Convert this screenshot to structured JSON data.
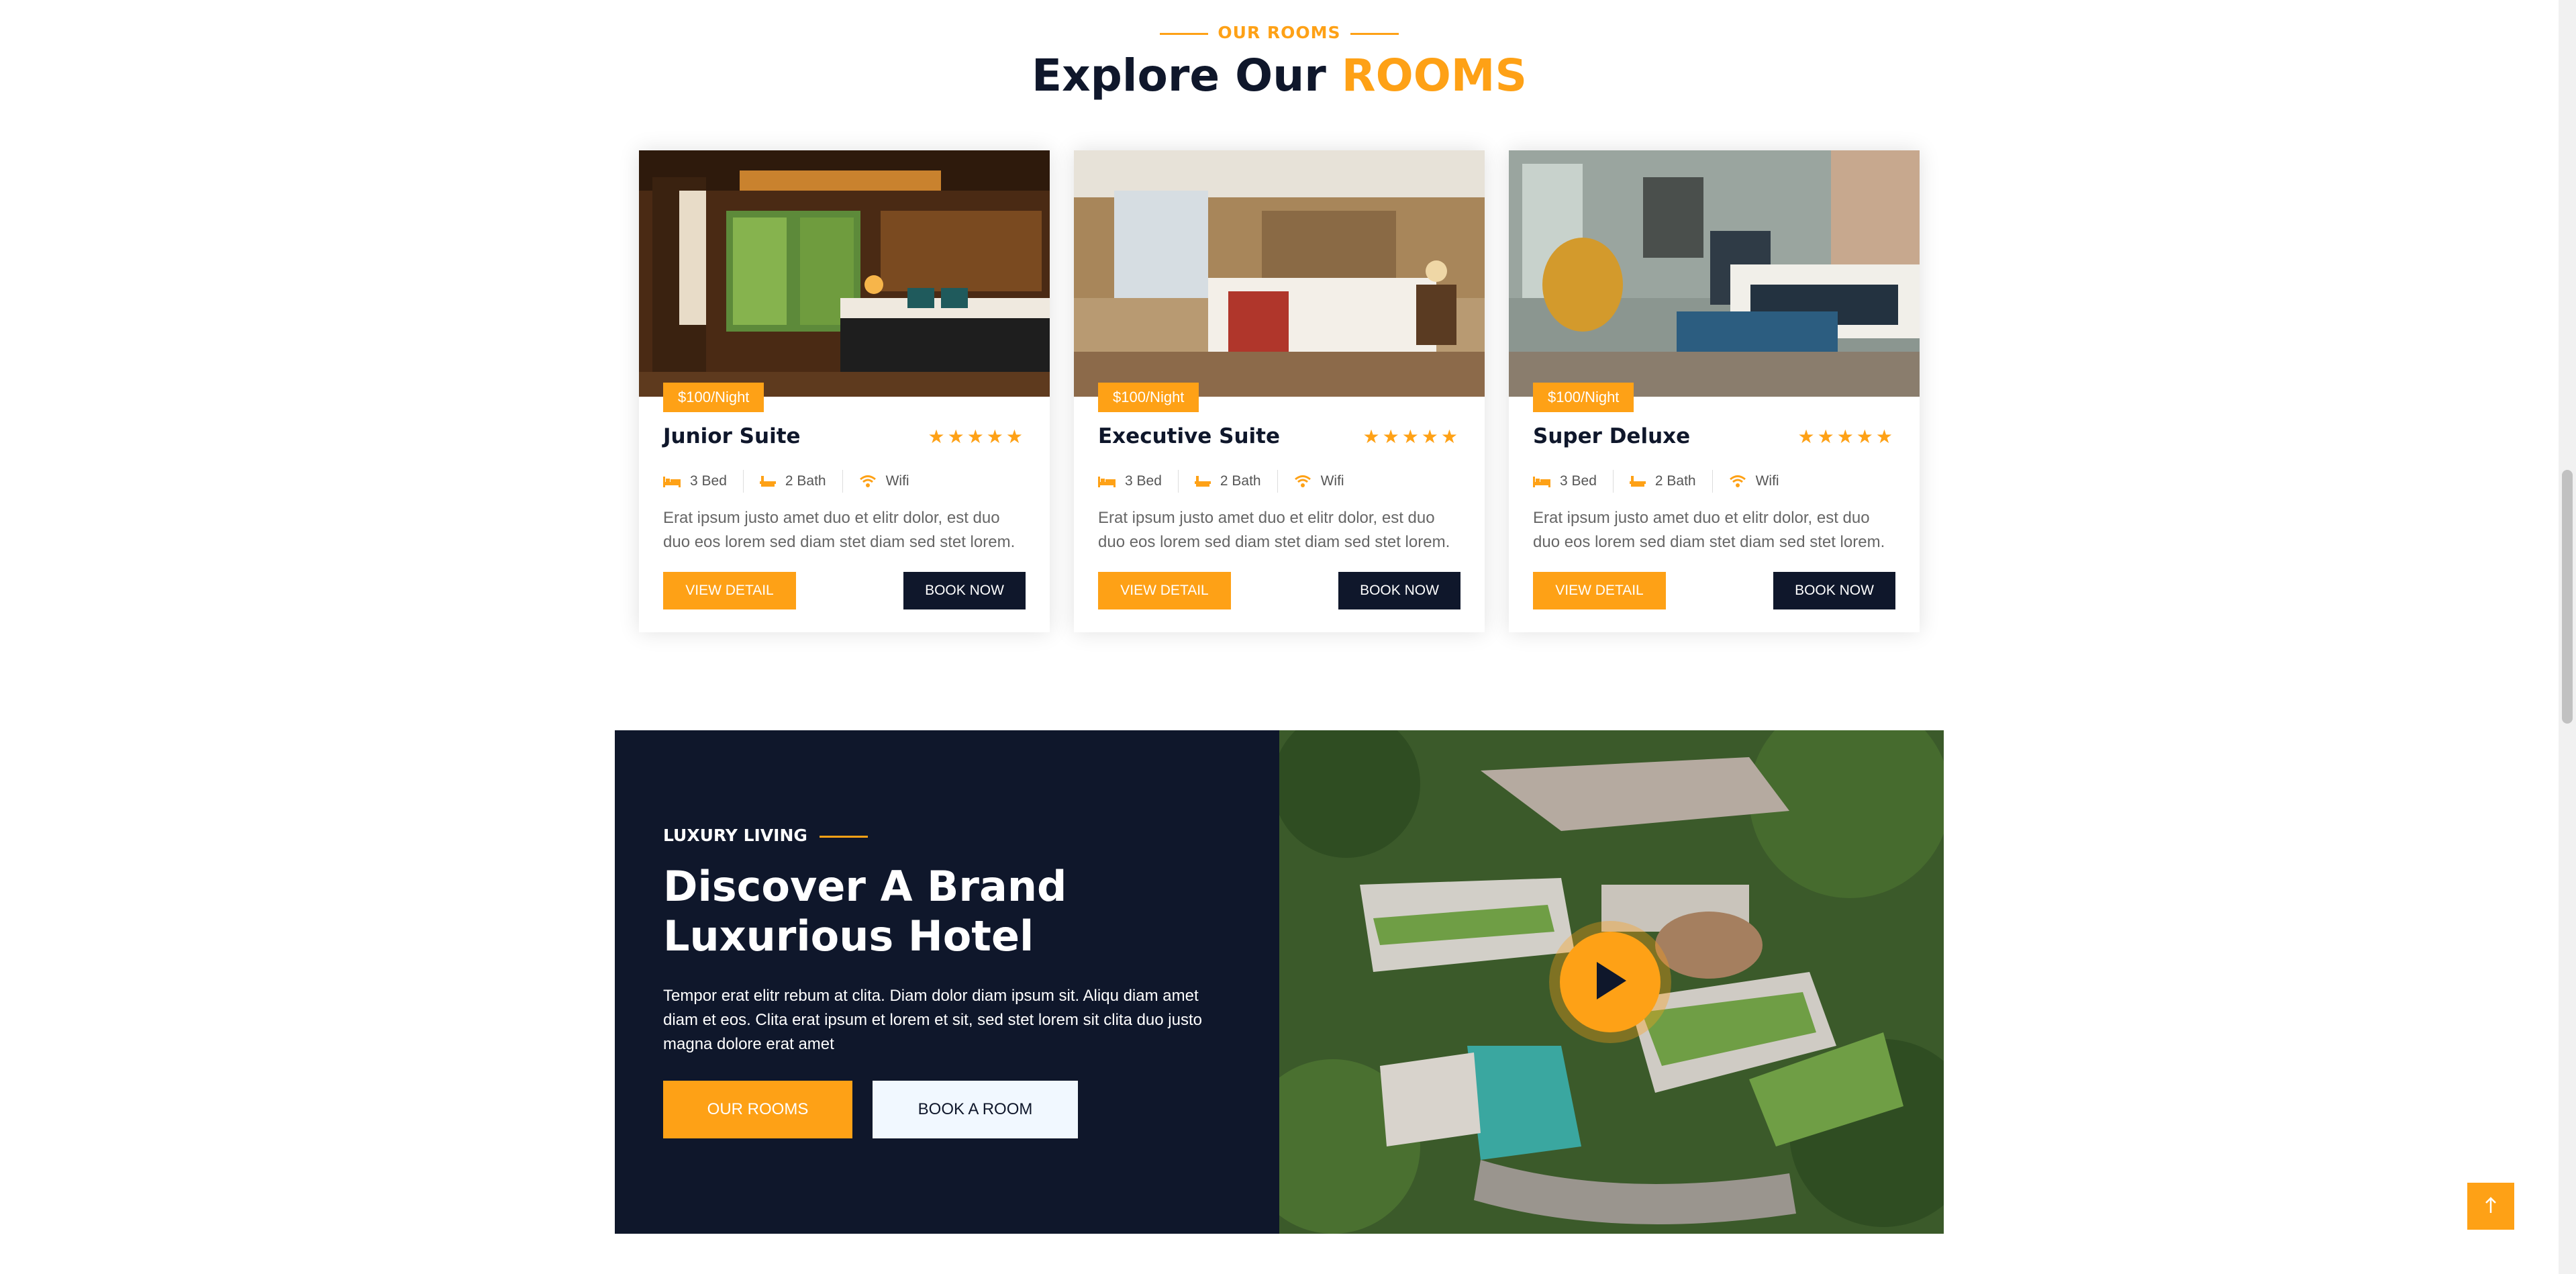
{
  "section": {
    "eyebrow": "OUR ROOMS",
    "title_main": "Explore Our",
    "title_accent": "ROOMS"
  },
  "rooms": [
    {
      "price": "$100/Night",
      "name": "Junior Suite",
      "stars": "★★★★★",
      "bed": "3 Bed",
      "bath": "2 Bath",
      "wifi": "Wifi",
      "description": "Erat ipsum justo amet duo et elitr dolor, est duo duo eos lorem sed diam stet diam sed stet lorem.",
      "view_label": "VIEW DETAIL",
      "book_label": "BOOK NOW"
    },
    {
      "price": "$100/Night",
      "name": "Executive Suite",
      "stars": "★★★★★",
      "bed": "3 Bed",
      "bath": "2 Bath",
      "wifi": "Wifi",
      "description": "Erat ipsum justo amet duo et elitr dolor, est duo duo eos lorem sed diam stet diam sed stet lorem.",
      "view_label": "VIEW DETAIL",
      "book_label": "BOOK NOW"
    },
    {
      "price": "$100/Night",
      "name": "Super Deluxe",
      "stars": "★★★★★",
      "bed": "3 Bed",
      "bath": "2 Bath",
      "wifi": "Wifi",
      "description": "Erat ipsum justo amet duo et elitr dolor, est duo duo eos lorem sed diam stet diam sed stet lorem.",
      "view_label": "VIEW DETAIL",
      "book_label": "BOOK NOW"
    }
  ],
  "luxury": {
    "eyebrow": "LUXURY LIVING",
    "title_line1": "Discover A Brand",
    "title_line2": "Luxurious Hotel",
    "text": "Tempor erat elitr rebum at clita. Diam dolor diam ipsum sit. Aliqu diam amet diam et eos. Clita erat ipsum et lorem et sit, sed stet lorem sit clita duo justo magna dolore erat amet",
    "btn_rooms": "OUR ROOMS",
    "btn_book": "BOOK A ROOM"
  },
  "icons": {
    "bed": "bed-icon",
    "bath": "bath-icon",
    "wifi": "wifi-icon",
    "play": "play-icon",
    "back_to_top": "arrow-up-icon"
  },
  "colors": {
    "accent": "#fea116",
    "dark": "#0f172b",
    "light_button": "#f1f8ff"
  }
}
